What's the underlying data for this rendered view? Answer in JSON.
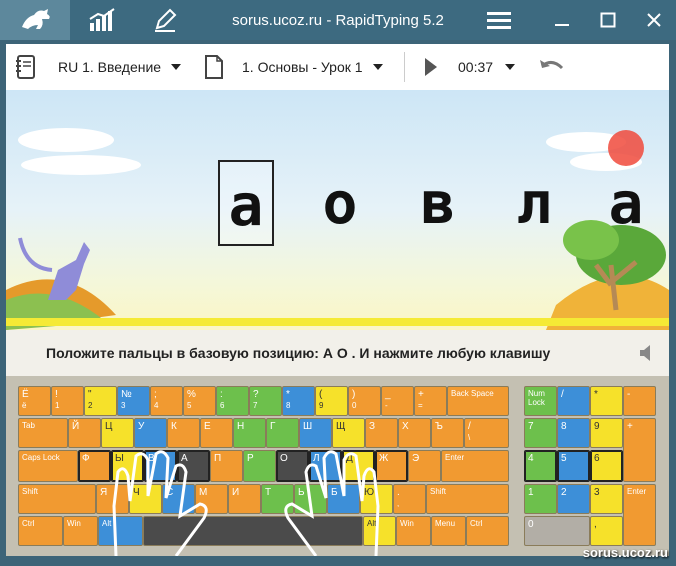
{
  "window": {
    "title": "sorus.ucoz.ru - RapidTyping 5.2"
  },
  "toolbar": {
    "language": "RU 1. Введение",
    "lesson": "1. Основы - Урок 1",
    "timer": "00:37"
  },
  "exercise": {
    "letters": [
      "а",
      "о",
      "в",
      "л",
      "а"
    ],
    "current_index": 0
  },
  "instruction": "Положите пальцы в базовую позицию:  А  О .  И нажмите любую клавишу",
  "keyboard": {
    "row0": [
      [
        "Ё",
        "ё"
      ],
      [
        "!",
        "1"
      ],
      [
        "\"",
        "2"
      ],
      [
        "№",
        "3"
      ],
      [
        ";",
        "4"
      ],
      [
        "%",
        "5"
      ],
      [
        ":",
        "6"
      ],
      [
        "?",
        "7"
      ],
      [
        "*",
        "8"
      ],
      [
        "(",
        "9"
      ],
      [
        ")",
        "0"
      ],
      [
        "_",
        "-"
      ],
      [
        "+",
        "="
      ],
      [
        "Back Space",
        ""
      ]
    ],
    "row1": [
      "Tab",
      "Й",
      "Ц",
      "У",
      "К",
      "Е",
      "Н",
      "Г",
      "Ш",
      "Щ",
      "З",
      "Х",
      "Ъ",
      "/"
    ],
    "row1_sub": {
      "13": "\\"
    },
    "row2": [
      "Caps Lock",
      "Ф",
      "Ы",
      "В",
      "А",
      "П",
      "Р",
      "О",
      "Л",
      "Д",
      "Ж",
      "Э",
      "Enter"
    ],
    "row3": [
      "Shift",
      "Я",
      "Ч",
      "С",
      "М",
      "И",
      "Т",
      "Ь",
      "Б",
      "Ю",
      ".",
      ",",
      "Shift"
    ],
    "row4": [
      "Ctrl",
      "Win",
      "Alt",
      "",
      "Alt",
      "Win",
      "Menu",
      "Ctrl"
    ],
    "numpad": {
      "r0": [
        "Num Lock",
        "/",
        "*",
        "-"
      ],
      "r1": [
        "7",
        "8",
        "9",
        "+"
      ],
      "r2": [
        "4",
        "5",
        "6"
      ],
      "r3": [
        "1",
        "2",
        "3",
        "Enter"
      ],
      "r4": [
        "0",
        ","
      ]
    }
  },
  "watermark": "sorus.ucoz.ru",
  "colors": {
    "titlebar": "#3d6a80",
    "orange": "#f19a31",
    "yellow": "#f6e12a",
    "blue": "#3d8fd8",
    "green": "#6dc04c"
  }
}
